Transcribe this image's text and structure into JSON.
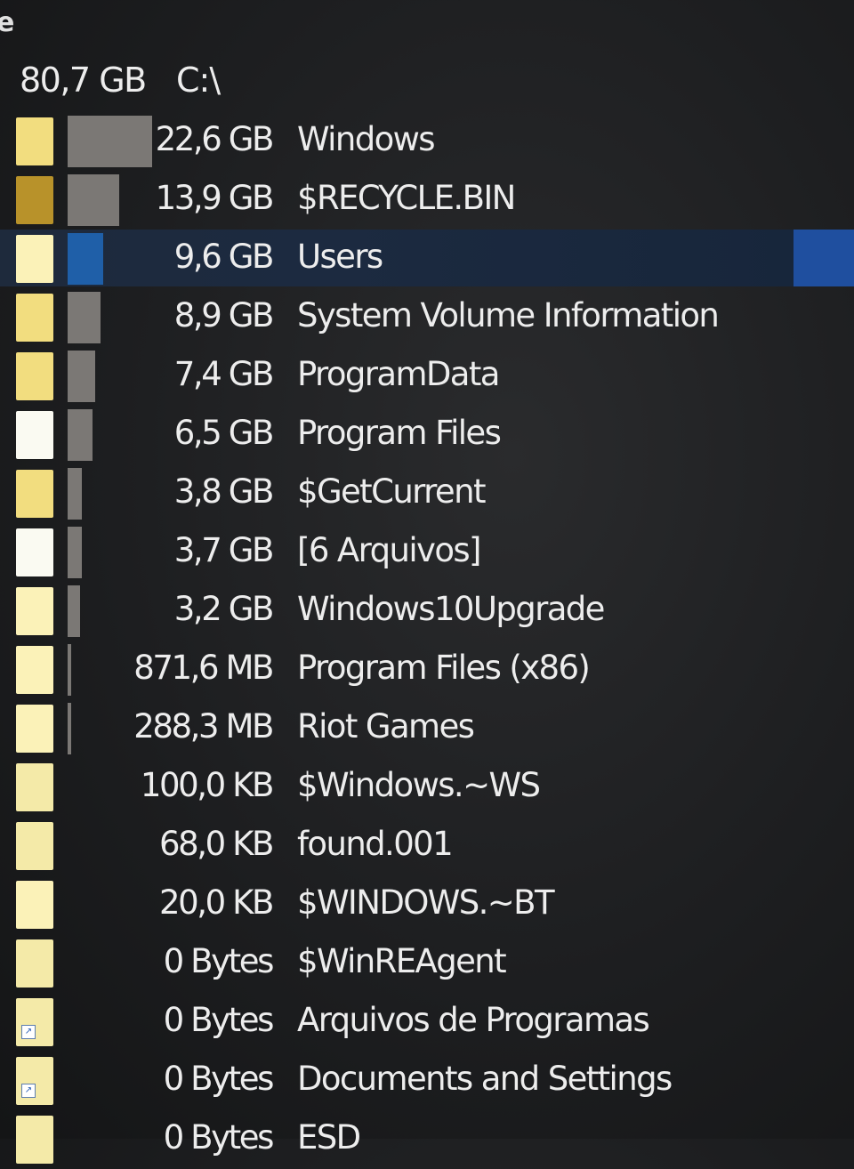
{
  "edge_char": "e",
  "root": {
    "size": "80,7 GB",
    "path": "C:\\"
  },
  "items": [
    {
      "size": "22,6 GB",
      "name": "Windows",
      "fraction": 0.28,
      "folder": "std",
      "shortcut": false
    },
    {
      "size": "13,9 GB",
      "name": "$RECYCLE.BIN",
      "fraction": 0.172,
      "folder": "dark",
      "shortcut": false
    },
    {
      "size": "9,6 GB",
      "name": "Users",
      "fraction": 0.119,
      "folder": "bright",
      "shortcut": false,
      "selected": true
    },
    {
      "size": "8,9 GB",
      "name": "System Volume Information",
      "fraction": 0.11,
      "folder": "std",
      "shortcut": false
    },
    {
      "size": "7,4 GB",
      "name": "ProgramData",
      "fraction": 0.092,
      "folder": "std",
      "shortcut": false
    },
    {
      "size": "6,5 GB",
      "name": "Program Files",
      "fraction": 0.081,
      "folder": "white",
      "shortcut": false
    },
    {
      "size": "3,8 GB",
      "name": "$GetCurrent",
      "fraction": 0.047,
      "folder": "std",
      "shortcut": false
    },
    {
      "size": "3,7 GB",
      "name": "[6 Arquivos]",
      "fraction": 0.046,
      "folder": "white",
      "shortcut": false
    },
    {
      "size": "3,2 GB",
      "name": "Windows10Upgrade",
      "fraction": 0.04,
      "folder": "bright",
      "shortcut": false
    },
    {
      "size": "871,6 MB",
      "name": "Program Files (x86)",
      "fraction": 0.011,
      "folder": "bright",
      "shortcut": false
    },
    {
      "size": "288,3 MB",
      "name": "Riot Games",
      "fraction": 0.004,
      "folder": "bright",
      "shortcut": false
    },
    {
      "size": "100,0 KB",
      "name": "$Windows.~WS",
      "fraction": 0,
      "folder": "pale",
      "shortcut": false
    },
    {
      "size": "68,0 KB",
      "name": "found.001",
      "fraction": 0,
      "folder": "pale",
      "shortcut": false
    },
    {
      "size": "20,0 KB",
      "name": "$WINDOWS.~BT",
      "fraction": 0,
      "folder": "bright",
      "shortcut": false
    },
    {
      "size": "0 Bytes",
      "name": "$WinREAgent",
      "fraction": 0,
      "folder": "pale",
      "shortcut": false
    },
    {
      "size": "0 Bytes",
      "name": "Arquivos de Programas",
      "fraction": 0,
      "folder": "pale",
      "shortcut": true
    },
    {
      "size": "0 Bytes",
      "name": "Documents and Settings",
      "fraction": 0,
      "folder": "pale",
      "shortcut": true
    },
    {
      "size": "0 Bytes",
      "name": "ESD",
      "fraction": 0,
      "folder": "pale",
      "shortcut": false
    }
  ],
  "colors": {
    "background": "#1b1c1e",
    "selection": "#1f4f9f",
    "bar": "#7b7875",
    "folder": "#f2dd7f"
  }
}
